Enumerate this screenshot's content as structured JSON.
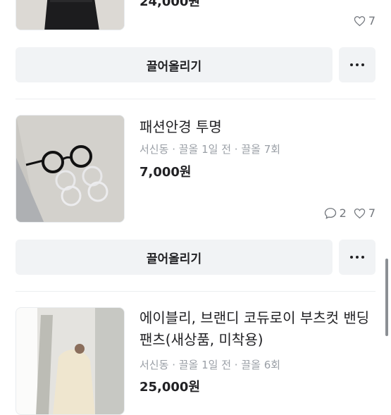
{
  "listings": [
    {
      "price": "24,000원",
      "likes": "7"
    },
    {
      "title": "패션안경 투명",
      "location": "서신동",
      "time": "끌올 1일 전",
      "bump_count": "끌올 7회",
      "price": "7,000원",
      "comments": "2",
      "likes": "7"
    },
    {
      "title": "에이블리, 브랜디 코듀로이 부츠컷 밴딩 팬츠(새상품, 미착용)",
      "location": "서신동",
      "time": "끌올 1일 전",
      "bump_count": "끌올 6회",
      "price": "25,000원"
    }
  ],
  "actions": {
    "bump_label": "끌어올리기"
  },
  "icons": {
    "more": "more-horizontal-icon",
    "heart": "heart-icon",
    "comment": "chat-bubble-icon"
  },
  "colors": {
    "button_bg": "#f1f3f5",
    "meta_text": "#9a9fa6"
  }
}
